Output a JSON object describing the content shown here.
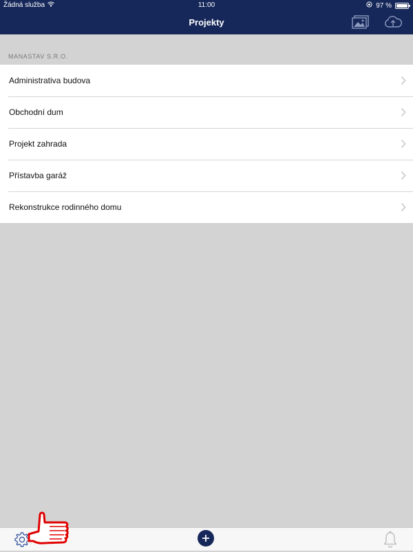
{
  "status_bar": {
    "carrier": "Žádná služba",
    "time": "11:00",
    "battery_percent": "97 %",
    "battery_level": 0.97,
    "icons": [
      "wifi-icon",
      "orientation-lock-icon",
      "battery-icon"
    ]
  },
  "nav": {
    "title": "Projekty",
    "icons": [
      "gallery-icon",
      "cloud-upload-icon"
    ]
  },
  "section": {
    "header": "MANASTAV S.R.O."
  },
  "projects": [
    {
      "label": "Administrativa budova"
    },
    {
      "label": "Obchodní dum"
    },
    {
      "label": "Projekt zahrada"
    },
    {
      "label": "Přístavba garáž"
    },
    {
      "label": "Rekonstrukce rodinného domu"
    }
  ],
  "tab_bar": {
    "icons": [
      "gear-icon",
      "add-icon",
      "bell-icon"
    ]
  },
  "colors": {
    "nav_background": "#16285a",
    "page_background": "#d3d3d3",
    "annotation": "#e00000"
  }
}
